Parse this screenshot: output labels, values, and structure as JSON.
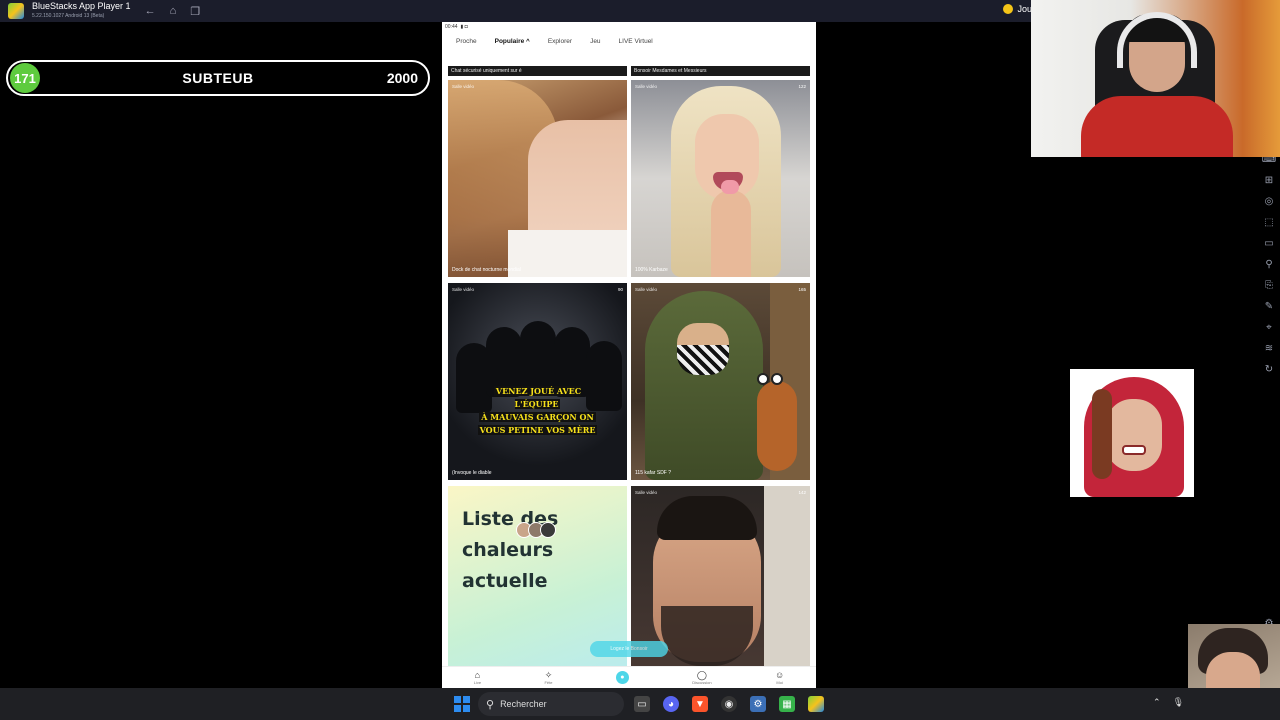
{
  "window": {
    "title": "BlueStacks App Player 1",
    "subtitle": "5.22.150.1027  Android 13 (Beta)",
    "right_label": "Jou"
  },
  "sub_goal": {
    "current": "171",
    "label": "SUBTEUB",
    "goal": "2000",
    "progress_fraction": 0.0855,
    "accent_color": "#5ecb3e"
  },
  "app": {
    "status_time": "00:44",
    "tabs": [
      {
        "label": "Proche",
        "active": false
      },
      {
        "label": "Populaire ^",
        "active": true
      },
      {
        "label": "Explorer",
        "active": false
      },
      {
        "label": "Jeu",
        "active": false
      },
      {
        "label": "LIVE Virtuel",
        "active": false
      }
    ],
    "banners": [
      "Chat sécurisé uniquement sur é",
      "Bonsoir Mesdames et Messieurs"
    ],
    "cards": [
      {
        "tag": "Salle vidéo",
        "viewers": "",
        "caption": "Dock de chat nocturne mondial"
      },
      {
        "tag": "Salle vidéo",
        "viewers": "122",
        "caption": "100% Karbaze"
      },
      {
        "tag": "Salle vidéo",
        "viewers": "90",
        "caption": "(Invoque le diable",
        "overlay_text": [
          "VENEZ JOUÉ AVEC L'ÉQUIPE",
          "À MAUVAIS GARÇON ON",
          "VOUS PETINE VOS MÈRE"
        ]
      },
      {
        "tag": "Salle vidéo",
        "viewers": "165",
        "caption": "115 kafar SDF ?"
      },
      {
        "tag": "",
        "viewers": "",
        "caption": "",
        "headline": [
          "Liste des",
          "chaleurs",
          "actuelle"
        ]
      },
      {
        "tag": "Salle vidéo",
        "viewers": "142",
        "caption": ""
      }
    ],
    "floating_pill": "Logez le Bonsoir",
    "bottom_nav": [
      {
        "icon": "home-icon",
        "label": "Live"
      },
      {
        "icon": "party-icon",
        "label": "Fête"
      },
      {
        "icon": "live-icon",
        "label": ""
      },
      {
        "icon": "chat-icon",
        "label": "Discussion"
      },
      {
        "icon": "profile-icon",
        "label": "Moi"
      }
    ]
  },
  "taskbar": {
    "search_placeholder": "Rechercher"
  }
}
